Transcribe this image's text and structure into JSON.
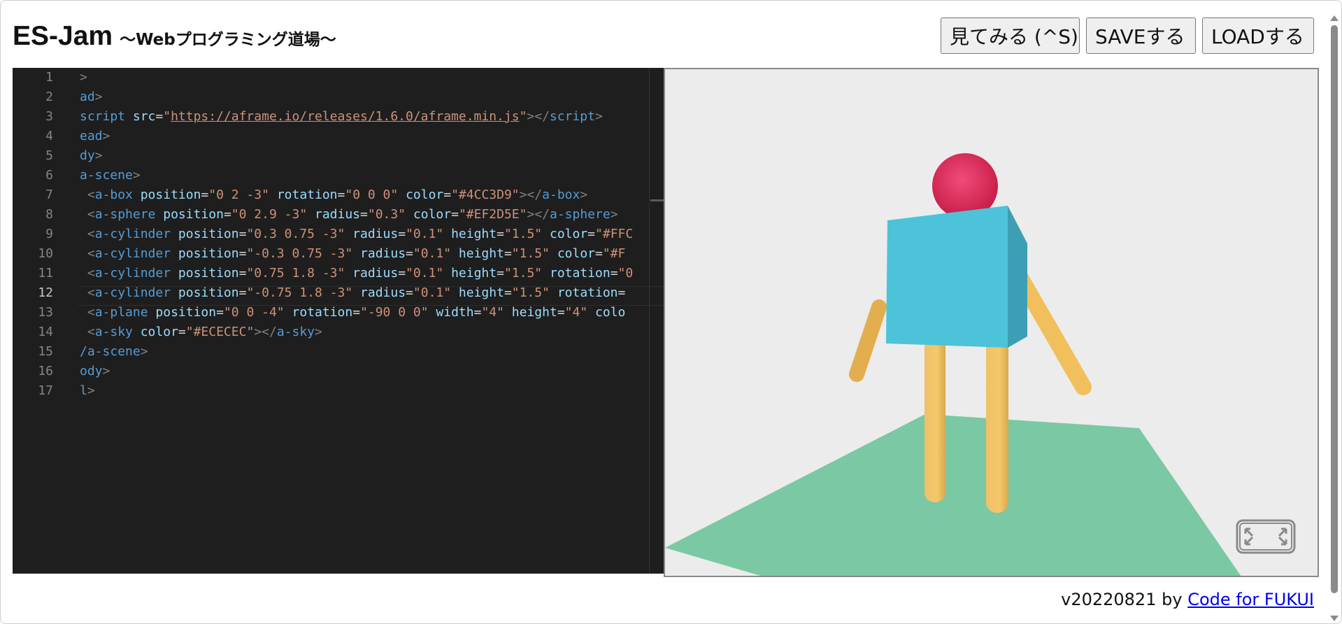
{
  "header": {
    "title": "ES-Jam",
    "subtitle": "～Webプログラミング道場～",
    "buttons": {
      "preview": "見てみる (^S)",
      "save": "SAVEする",
      "load": "LOADする"
    }
  },
  "editor": {
    "active_line": 12,
    "lines": [
      {
        "n": "1",
        "code": [
          [
            "p",
            ">"
          ]
        ]
      },
      {
        "n": "2",
        "code": [
          [
            "t",
            "ad"
          ],
          [
            "p",
            ">"
          ]
        ]
      },
      {
        "n": "3",
        "code": [
          [
            "t",
            "script "
          ],
          [
            "a",
            "src"
          ],
          [
            "d",
            "="
          ],
          [
            "v",
            "\""
          ],
          [
            "vu",
            "https://aframe.io/releases/1.6.0/aframe.min.js"
          ],
          [
            "v",
            "\""
          ],
          [
            "p",
            "></"
          ],
          [
            "t",
            "script"
          ],
          [
            "p",
            ">"
          ]
        ]
      },
      {
        "n": "4",
        "code": [
          [
            "t",
            "ead"
          ],
          [
            "p",
            ">"
          ]
        ]
      },
      {
        "n": "5",
        "code": [
          [
            "t",
            "dy"
          ],
          [
            "p",
            ">"
          ]
        ]
      },
      {
        "n": "6",
        "code": [
          [
            "t",
            "a-scene"
          ],
          [
            "p",
            ">"
          ]
        ]
      },
      {
        "n": "7",
        "code": [
          [
            "d",
            " "
          ],
          [
            "p",
            "<"
          ],
          [
            "t",
            "a-box "
          ],
          [
            "a",
            "position"
          ],
          [
            "d",
            "="
          ],
          [
            "v",
            "\"0 2 -3\" "
          ],
          [
            "a",
            "rotation"
          ],
          [
            "d",
            "="
          ],
          [
            "v",
            "\"0 0 0\" "
          ],
          [
            "a",
            "color"
          ],
          [
            "d",
            "="
          ],
          [
            "v",
            "\"#4CC3D9\""
          ],
          [
            "p",
            "></"
          ],
          [
            "t",
            "a-box"
          ],
          [
            "p",
            ">"
          ]
        ]
      },
      {
        "n": "8",
        "code": [
          [
            "d",
            " "
          ],
          [
            "p",
            "<"
          ],
          [
            "t",
            "a-sphere "
          ],
          [
            "a",
            "position"
          ],
          [
            "d",
            "="
          ],
          [
            "v",
            "\"0 2.9 -3\" "
          ],
          [
            "a",
            "radius"
          ],
          [
            "d",
            "="
          ],
          [
            "v",
            "\"0.3\" "
          ],
          [
            "a",
            "color"
          ],
          [
            "d",
            "="
          ],
          [
            "v",
            "\"#EF2D5E\""
          ],
          [
            "p",
            "></"
          ],
          [
            "t",
            "a-sphere"
          ],
          [
            "p",
            ">"
          ]
        ]
      },
      {
        "n": "9",
        "code": [
          [
            "d",
            " "
          ],
          [
            "p",
            "<"
          ],
          [
            "t",
            "a-cylinder "
          ],
          [
            "a",
            "position"
          ],
          [
            "d",
            "="
          ],
          [
            "v",
            "\"0.3 0.75 -3\" "
          ],
          [
            "a",
            "radius"
          ],
          [
            "d",
            "="
          ],
          [
            "v",
            "\"0.1\" "
          ],
          [
            "a",
            "height"
          ],
          [
            "d",
            "="
          ],
          [
            "v",
            "\"1.5\" "
          ],
          [
            "a",
            "color"
          ],
          [
            "d",
            "="
          ],
          [
            "v",
            "\"#FFC"
          ]
        ]
      },
      {
        "n": "10",
        "code": [
          [
            "d",
            " "
          ],
          [
            "p",
            "<"
          ],
          [
            "t",
            "a-cylinder "
          ],
          [
            "a",
            "position"
          ],
          [
            "d",
            "="
          ],
          [
            "v",
            "\"-0.3 0.75 -3\" "
          ],
          [
            "a",
            "radius"
          ],
          [
            "d",
            "="
          ],
          [
            "v",
            "\"0.1\" "
          ],
          [
            "a",
            "height"
          ],
          [
            "d",
            "="
          ],
          [
            "v",
            "\"1.5\" "
          ],
          [
            "a",
            "color"
          ],
          [
            "d",
            "="
          ],
          [
            "v",
            "\"#F"
          ]
        ]
      },
      {
        "n": "11",
        "code": [
          [
            "d",
            " "
          ],
          [
            "p",
            "<"
          ],
          [
            "t",
            "a-cylinder "
          ],
          [
            "a",
            "position"
          ],
          [
            "d",
            "="
          ],
          [
            "v",
            "\"0.75 1.8 -3\" "
          ],
          [
            "a",
            "radius"
          ],
          [
            "d",
            "="
          ],
          [
            "v",
            "\"0.1\" "
          ],
          [
            "a",
            "height"
          ],
          [
            "d",
            "="
          ],
          [
            "v",
            "\"1.5\" "
          ],
          [
            "a",
            "rotation"
          ],
          [
            "d",
            "="
          ],
          [
            "v",
            "\"0"
          ]
        ]
      },
      {
        "n": "12",
        "code": [
          [
            "d",
            " "
          ],
          [
            "p",
            "<"
          ],
          [
            "t",
            "a-cylinder "
          ],
          [
            "a",
            "position"
          ],
          [
            "d",
            "="
          ],
          [
            "v",
            "\"-0.75 1.8 -3\" "
          ],
          [
            "a",
            "radius"
          ],
          [
            "d",
            "="
          ],
          [
            "v",
            "\"0.1\" "
          ],
          [
            "a",
            "height"
          ],
          [
            "d",
            "="
          ],
          [
            "v",
            "\"1.5\" "
          ],
          [
            "a",
            "rotation"
          ],
          [
            "d",
            "="
          ]
        ]
      },
      {
        "n": "13",
        "code": [
          [
            "d",
            " "
          ],
          [
            "p",
            "<"
          ],
          [
            "t",
            "a-plane "
          ],
          [
            "a",
            "position"
          ],
          [
            "d",
            "="
          ],
          [
            "v",
            "\"0 0 -4\" "
          ],
          [
            "a",
            "rotation"
          ],
          [
            "d",
            "="
          ],
          [
            "v",
            "\"-90 0 0\" "
          ],
          [
            "a",
            "width"
          ],
          [
            "d",
            "="
          ],
          [
            "v",
            "\"4\" "
          ],
          [
            "a",
            "height"
          ],
          [
            "d",
            "="
          ],
          [
            "v",
            "\"4\" "
          ],
          [
            "a",
            "colo"
          ]
        ]
      },
      {
        "n": "14",
        "code": [
          [
            "d",
            " "
          ],
          [
            "p",
            "<"
          ],
          [
            "t",
            "a-sky "
          ],
          [
            "a",
            "color"
          ],
          [
            "d",
            "="
          ],
          [
            "v",
            "\"#ECECEC\""
          ],
          [
            "p",
            "></"
          ],
          [
            "t",
            "a-sky"
          ],
          [
            "p",
            ">"
          ]
        ]
      },
      {
        "n": "15",
        "code": [
          [
            "t",
            "/a-scene"
          ],
          [
            "p",
            ">"
          ]
        ]
      },
      {
        "n": "16",
        "code": [
          [
            "t",
            "ody"
          ],
          [
            "p",
            ">"
          ]
        ]
      },
      {
        "n": "17",
        "code": [
          [
            "t",
            "l"
          ],
          [
            "p",
            ">"
          ]
        ]
      }
    ]
  },
  "preview": {
    "colors": {
      "sky": "#ECECEC",
      "box": "#4CC3D9",
      "sphere": "#EF2D5E",
      "cylinder": "#FFC65D",
      "plane": "#7BC8A4"
    },
    "fullscreen_icon": "fullscreen-icon"
  },
  "footer": {
    "version": "v20220821 by",
    "link_text": "Code for FUKUI"
  }
}
